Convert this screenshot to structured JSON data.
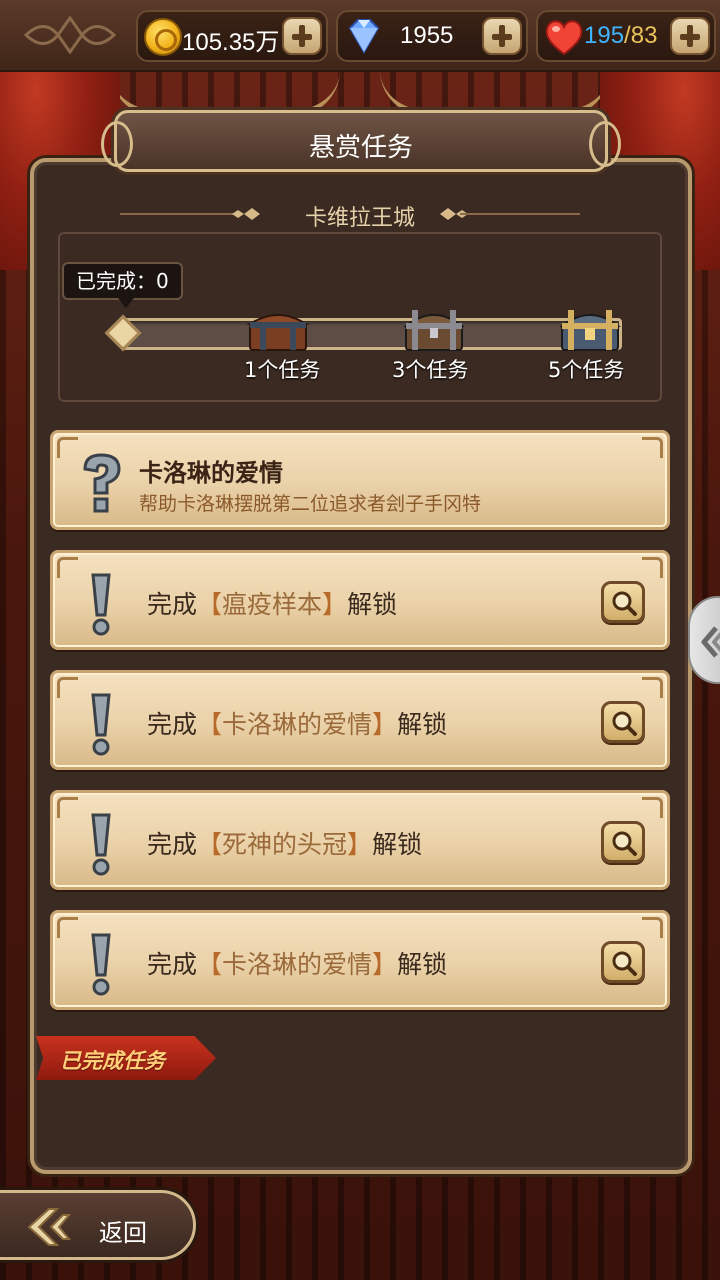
{
  "resources": {
    "coins": "105.35万",
    "gems": "1955",
    "hp_current": "195",
    "hp_separator": "/",
    "hp_max": "83"
  },
  "panel": {
    "title": "悬赏任务",
    "region": "卡维拉王城"
  },
  "progress": {
    "completed_label": "已完成：0",
    "completed_count": 0,
    "rewards": [
      {
        "label": "1个任务",
        "chest": "wooden-chest-icon"
      },
      {
        "label": "3个任务",
        "chest": "iron-chest-icon"
      },
      {
        "label": "5个任务",
        "chest": "golden-chest-icon"
      }
    ]
  },
  "quests": [
    {
      "type": "available",
      "title": "卡洛琳的爱情",
      "description": "帮助卡洛琳摆脱第二位追求者刽子手冈特",
      "icon": "question-mark-icon"
    },
    {
      "type": "locked",
      "prefix": "完成",
      "open_bracket": "【",
      "name": "瘟疫样本",
      "close_bracket": "】",
      "suffix": "解锁",
      "icon": "exclamation-icon"
    },
    {
      "type": "locked",
      "prefix": "完成",
      "open_bracket": "【",
      "name": "卡洛琳的爱情",
      "close_bracket": "】",
      "suffix": "解锁",
      "icon": "exclamation-icon"
    },
    {
      "type": "locked",
      "prefix": "完成",
      "open_bracket": "【",
      "name": "死神的头冠",
      "close_bracket": "】",
      "suffix": "解锁",
      "icon": "exclamation-icon"
    },
    {
      "type": "locked",
      "prefix": "完成",
      "open_bracket": "【",
      "name": "卡洛琳的爱情",
      "close_bracket": "】",
      "suffix": "解锁",
      "icon": "exclamation-icon"
    }
  ],
  "completed_tab": "已完成任务",
  "back_button": "返回",
  "colors": {
    "accent_gold": "#e5b64e",
    "hp_current": "#3fb4ff",
    "hp_max": "#e9c25a",
    "completed_tab": "#c8321e"
  }
}
